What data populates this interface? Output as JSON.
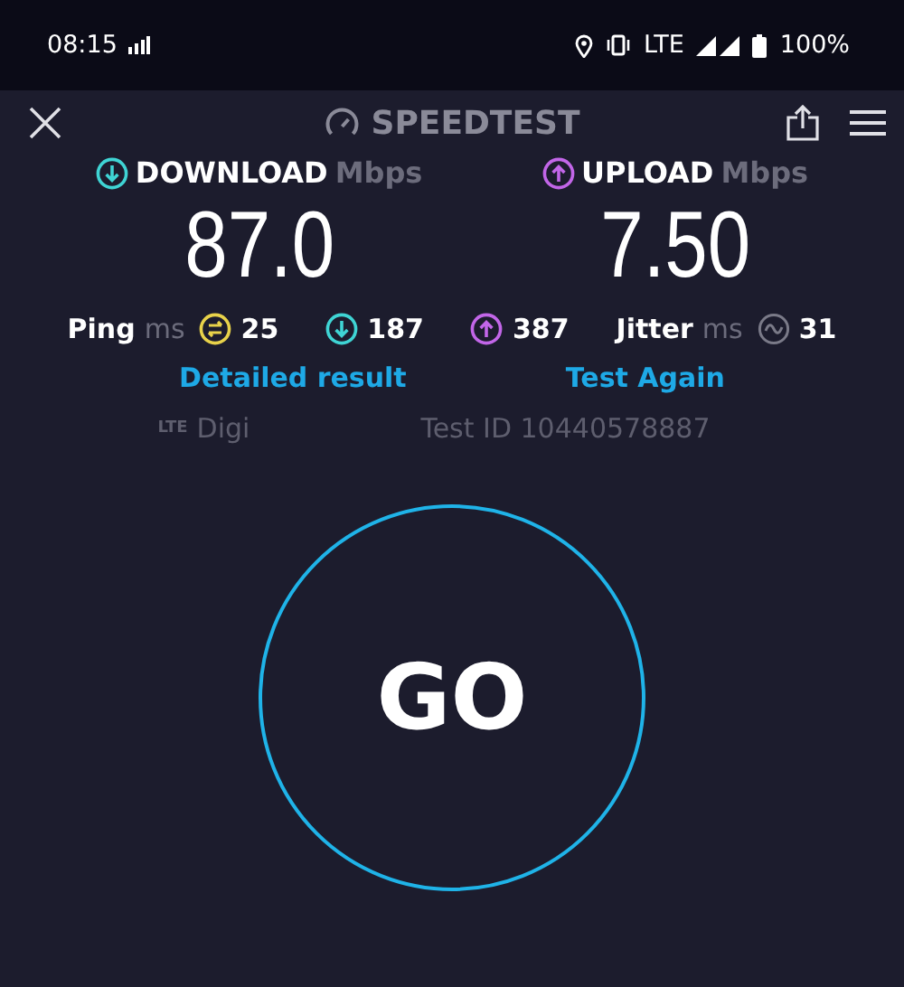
{
  "status_bar": {
    "time": "08:15",
    "network": "LTE",
    "battery": "100%"
  },
  "header": {
    "title": "SPEEDTEST"
  },
  "results": [
    {
      "kind": "download",
      "label": "DOWNLOAD",
      "unit": "Mbps",
      "value": "87.0"
    },
    {
      "kind": "upload",
      "label": "UPLOAD",
      "unit": "Mbps",
      "value": "7.50"
    }
  ],
  "stats": [
    {
      "kind": "ping",
      "label": "Ping",
      "unit": "ms",
      "value": "25"
    },
    {
      "kind": "download",
      "value": "187"
    },
    {
      "kind": "upload",
      "value": "387"
    },
    {
      "kind": "jitter",
      "label": "Jitter",
      "unit": "ms",
      "value": "31"
    }
  ],
  "links": [
    "Detailed result",
    "Test Again"
  ],
  "provider": {
    "technology": "LTE",
    "name": "Digi"
  },
  "test_id": "Test ID 10440578887",
  "go_button": "GO"
}
